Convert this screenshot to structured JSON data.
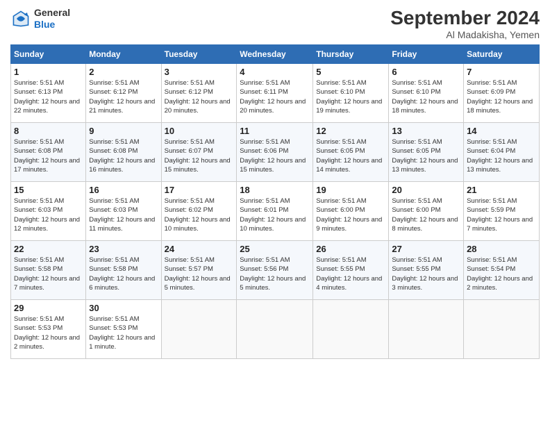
{
  "header": {
    "logo_line1": "General",
    "logo_line2": "Blue",
    "month": "September 2024",
    "location": "Al Madakisha, Yemen"
  },
  "weekdays": [
    "Sunday",
    "Monday",
    "Tuesday",
    "Wednesday",
    "Thursday",
    "Friday",
    "Saturday"
  ],
  "weeks": [
    [
      {
        "day": "1",
        "sunrise": "Sunrise: 5:51 AM",
        "sunset": "Sunset: 6:13 PM",
        "daylight": "Daylight: 12 hours and 22 minutes."
      },
      {
        "day": "2",
        "sunrise": "Sunrise: 5:51 AM",
        "sunset": "Sunset: 6:12 PM",
        "daylight": "Daylight: 12 hours and 21 minutes."
      },
      {
        "day": "3",
        "sunrise": "Sunrise: 5:51 AM",
        "sunset": "Sunset: 6:12 PM",
        "daylight": "Daylight: 12 hours and 20 minutes."
      },
      {
        "day": "4",
        "sunrise": "Sunrise: 5:51 AM",
        "sunset": "Sunset: 6:11 PM",
        "daylight": "Daylight: 12 hours and 20 minutes."
      },
      {
        "day": "5",
        "sunrise": "Sunrise: 5:51 AM",
        "sunset": "Sunset: 6:10 PM",
        "daylight": "Daylight: 12 hours and 19 minutes."
      },
      {
        "day": "6",
        "sunrise": "Sunrise: 5:51 AM",
        "sunset": "Sunset: 6:10 PM",
        "daylight": "Daylight: 12 hours and 18 minutes."
      },
      {
        "day": "7",
        "sunrise": "Sunrise: 5:51 AM",
        "sunset": "Sunset: 6:09 PM",
        "daylight": "Daylight: 12 hours and 18 minutes."
      }
    ],
    [
      {
        "day": "8",
        "sunrise": "Sunrise: 5:51 AM",
        "sunset": "Sunset: 6:08 PM",
        "daylight": "Daylight: 12 hours and 17 minutes."
      },
      {
        "day": "9",
        "sunrise": "Sunrise: 5:51 AM",
        "sunset": "Sunset: 6:08 PM",
        "daylight": "Daylight: 12 hours and 16 minutes."
      },
      {
        "day": "10",
        "sunrise": "Sunrise: 5:51 AM",
        "sunset": "Sunset: 6:07 PM",
        "daylight": "Daylight: 12 hours and 15 minutes."
      },
      {
        "day": "11",
        "sunrise": "Sunrise: 5:51 AM",
        "sunset": "Sunset: 6:06 PM",
        "daylight": "Daylight: 12 hours and 15 minutes."
      },
      {
        "day": "12",
        "sunrise": "Sunrise: 5:51 AM",
        "sunset": "Sunset: 6:05 PM",
        "daylight": "Daylight: 12 hours and 14 minutes."
      },
      {
        "day": "13",
        "sunrise": "Sunrise: 5:51 AM",
        "sunset": "Sunset: 6:05 PM",
        "daylight": "Daylight: 12 hours and 13 minutes."
      },
      {
        "day": "14",
        "sunrise": "Sunrise: 5:51 AM",
        "sunset": "Sunset: 6:04 PM",
        "daylight": "Daylight: 12 hours and 13 minutes."
      }
    ],
    [
      {
        "day": "15",
        "sunrise": "Sunrise: 5:51 AM",
        "sunset": "Sunset: 6:03 PM",
        "daylight": "Daylight: 12 hours and 12 minutes."
      },
      {
        "day": "16",
        "sunrise": "Sunrise: 5:51 AM",
        "sunset": "Sunset: 6:03 PM",
        "daylight": "Daylight: 12 hours and 11 minutes."
      },
      {
        "day": "17",
        "sunrise": "Sunrise: 5:51 AM",
        "sunset": "Sunset: 6:02 PM",
        "daylight": "Daylight: 12 hours and 10 minutes."
      },
      {
        "day": "18",
        "sunrise": "Sunrise: 5:51 AM",
        "sunset": "Sunset: 6:01 PM",
        "daylight": "Daylight: 12 hours and 10 minutes."
      },
      {
        "day": "19",
        "sunrise": "Sunrise: 5:51 AM",
        "sunset": "Sunset: 6:00 PM",
        "daylight": "Daylight: 12 hours and 9 minutes."
      },
      {
        "day": "20",
        "sunrise": "Sunrise: 5:51 AM",
        "sunset": "Sunset: 6:00 PM",
        "daylight": "Daylight: 12 hours and 8 minutes."
      },
      {
        "day": "21",
        "sunrise": "Sunrise: 5:51 AM",
        "sunset": "Sunset: 5:59 PM",
        "daylight": "Daylight: 12 hours and 7 minutes."
      }
    ],
    [
      {
        "day": "22",
        "sunrise": "Sunrise: 5:51 AM",
        "sunset": "Sunset: 5:58 PM",
        "daylight": "Daylight: 12 hours and 7 minutes."
      },
      {
        "day": "23",
        "sunrise": "Sunrise: 5:51 AM",
        "sunset": "Sunset: 5:58 PM",
        "daylight": "Daylight: 12 hours and 6 minutes."
      },
      {
        "day": "24",
        "sunrise": "Sunrise: 5:51 AM",
        "sunset": "Sunset: 5:57 PM",
        "daylight": "Daylight: 12 hours and 5 minutes."
      },
      {
        "day": "25",
        "sunrise": "Sunrise: 5:51 AM",
        "sunset": "Sunset: 5:56 PM",
        "daylight": "Daylight: 12 hours and 5 minutes."
      },
      {
        "day": "26",
        "sunrise": "Sunrise: 5:51 AM",
        "sunset": "Sunset: 5:55 PM",
        "daylight": "Daylight: 12 hours and 4 minutes."
      },
      {
        "day": "27",
        "sunrise": "Sunrise: 5:51 AM",
        "sunset": "Sunset: 5:55 PM",
        "daylight": "Daylight: 12 hours and 3 minutes."
      },
      {
        "day": "28",
        "sunrise": "Sunrise: 5:51 AM",
        "sunset": "Sunset: 5:54 PM",
        "daylight": "Daylight: 12 hours and 2 minutes."
      }
    ],
    [
      {
        "day": "29",
        "sunrise": "Sunrise: 5:51 AM",
        "sunset": "Sunset: 5:53 PM",
        "daylight": "Daylight: 12 hours and 2 minutes."
      },
      {
        "day": "30",
        "sunrise": "Sunrise: 5:51 AM",
        "sunset": "Sunset: 5:53 PM",
        "daylight": "Daylight: 12 hours and 1 minute."
      },
      null,
      null,
      null,
      null,
      null
    ]
  ]
}
